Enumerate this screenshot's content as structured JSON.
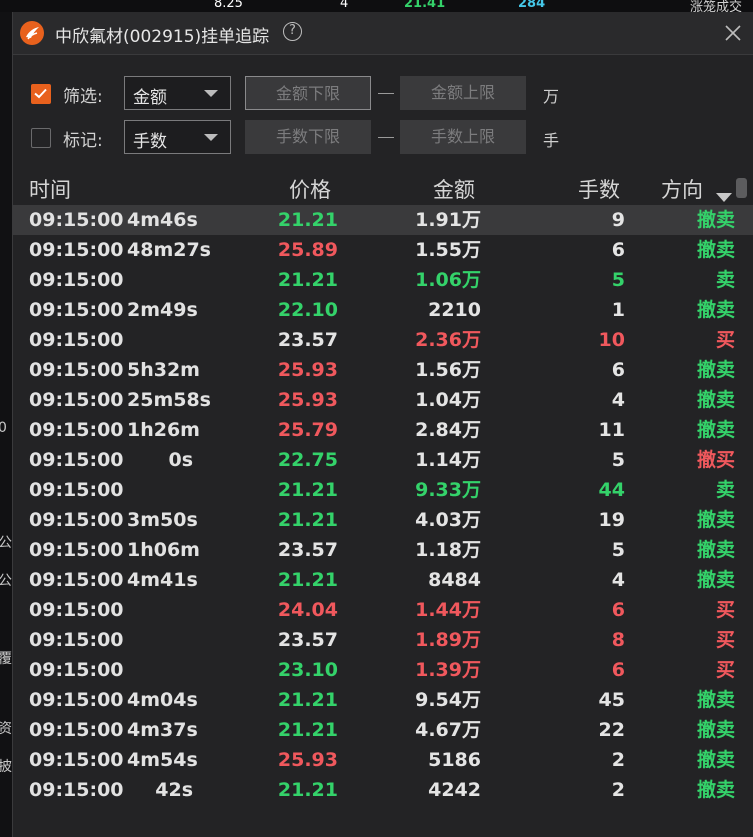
{
  "background_window": {
    "top_texts": [
      "8.25",
      "4",
      "21.41",
      "284",
      "涨笼成交"
    ],
    "left_edge_texts": [
      "0",
      "公",
      "公",
      "覆",
      "资",
      "披"
    ]
  },
  "window": {
    "title": "中欣氟材(002915)挂单追踪",
    "help_glyph": "?"
  },
  "filter_row": {
    "checkbox_checked": true,
    "label": "筛选:",
    "select_value": "金额",
    "lower_placeholder": "金额下限",
    "upper_placeholder": "金额上限",
    "unit": "万"
  },
  "mark_row": {
    "checkbox_checked": false,
    "label": "标记:",
    "select_value": "手数",
    "lower_placeholder": "手数下限",
    "upper_placeholder": "手数上限",
    "unit": "手"
  },
  "table": {
    "headers": {
      "time": "时间",
      "price": "价格",
      "amount": "金额",
      "lots": "手数",
      "direction": "方向"
    },
    "rows": [
      {
        "time": "09:15:00",
        "duration": "4m46s",
        "price": "21.21",
        "price_color": "g",
        "amount": "1.91万",
        "amount_color": "w",
        "lots": "9",
        "lots_color": "w",
        "direction": "撤卖",
        "direction_color": "g"
      },
      {
        "time": "09:15:00",
        "duration": "48m27s",
        "price": "25.89",
        "price_color": "r",
        "amount": "1.55万",
        "amount_color": "w",
        "lots": "6",
        "lots_color": "w",
        "direction": "撤卖",
        "direction_color": "g"
      },
      {
        "time": "09:15:00",
        "duration": "",
        "price": "21.21",
        "price_color": "g",
        "amount": "1.06万",
        "amount_color": "g",
        "lots": "5",
        "lots_color": "g",
        "direction": "卖",
        "direction_color": "g"
      },
      {
        "time": "09:15:00",
        "duration": "2m49s",
        "price": "22.10",
        "price_color": "g",
        "amount": "2210",
        "amount_color": "w",
        "lots": "1",
        "lots_color": "w",
        "direction": "撤卖",
        "direction_color": "g"
      },
      {
        "time": "09:15:00",
        "duration": "",
        "price": "23.57",
        "price_color": "w",
        "amount": "2.36万",
        "amount_color": "r",
        "lots": "10",
        "lots_color": "r",
        "direction": "买",
        "direction_color": "r"
      },
      {
        "time": "09:15:00",
        "duration": "5h32m",
        "price": "25.93",
        "price_color": "r",
        "amount": "1.56万",
        "amount_color": "w",
        "lots": "6",
        "lots_color": "w",
        "direction": "撤卖",
        "direction_color": "g"
      },
      {
        "time": "09:15:00",
        "duration": "25m58s",
        "price": "25.93",
        "price_color": "r",
        "amount": "1.04万",
        "amount_color": "w",
        "lots": "4",
        "lots_color": "w",
        "direction": "撤卖",
        "direction_color": "g"
      },
      {
        "time": "09:15:00",
        "duration": "1h26m",
        "price": "25.79",
        "price_color": "r",
        "amount": "2.84万",
        "amount_color": "w",
        "lots": "11",
        "lots_color": "w",
        "direction": "撤卖",
        "direction_color": "g"
      },
      {
        "time": "09:15:00",
        "duration": "0s",
        "price": "22.75",
        "price_color": "g",
        "amount": "1.14万",
        "amount_color": "w",
        "lots": "5",
        "lots_color": "w",
        "direction": "撤买",
        "direction_color": "r"
      },
      {
        "time": "09:15:00",
        "duration": "",
        "price": "21.21",
        "price_color": "g",
        "amount": "9.33万",
        "amount_color": "g",
        "lots": "44",
        "lots_color": "g",
        "direction": "卖",
        "direction_color": "g"
      },
      {
        "time": "09:15:00",
        "duration": "3m50s",
        "price": "21.21",
        "price_color": "g",
        "amount": "4.03万",
        "amount_color": "w",
        "lots": "19",
        "lots_color": "w",
        "direction": "撤卖",
        "direction_color": "g"
      },
      {
        "time": "09:15:00",
        "duration": "1h06m",
        "price": "23.57",
        "price_color": "w",
        "amount": "1.18万",
        "amount_color": "w",
        "lots": "5",
        "lots_color": "w",
        "direction": "撤卖",
        "direction_color": "g"
      },
      {
        "time": "09:15:00",
        "duration": "4m41s",
        "price": "21.21",
        "price_color": "g",
        "amount": "8484",
        "amount_color": "w",
        "lots": "4",
        "lots_color": "w",
        "direction": "撤卖",
        "direction_color": "g"
      },
      {
        "time": "09:15:00",
        "duration": "",
        "price": "24.04",
        "price_color": "r",
        "amount": "1.44万",
        "amount_color": "r",
        "lots": "6",
        "lots_color": "r",
        "direction": "买",
        "direction_color": "r"
      },
      {
        "time": "09:15:00",
        "duration": "",
        "price": "23.57",
        "price_color": "w",
        "amount": "1.89万",
        "amount_color": "r",
        "lots": "8",
        "lots_color": "r",
        "direction": "买",
        "direction_color": "r"
      },
      {
        "time": "09:15:00",
        "duration": "",
        "price": "23.10",
        "price_color": "g",
        "amount": "1.39万",
        "amount_color": "r",
        "lots": "6",
        "lots_color": "r",
        "direction": "买",
        "direction_color": "r"
      },
      {
        "time": "09:15:00",
        "duration": "4m04s",
        "price": "21.21",
        "price_color": "g",
        "amount": "9.54万",
        "amount_color": "w",
        "lots": "45",
        "lots_color": "w",
        "direction": "撤卖",
        "direction_color": "g"
      },
      {
        "time": "09:15:00",
        "duration": "4m37s",
        "price": "21.21",
        "price_color": "g",
        "amount": "4.67万",
        "amount_color": "w",
        "lots": "22",
        "lots_color": "w",
        "direction": "撤卖",
        "direction_color": "g"
      },
      {
        "time": "09:15:00",
        "duration": "4m54s",
        "price": "25.93",
        "price_color": "r",
        "amount": "5186",
        "amount_color": "w",
        "lots": "2",
        "lots_color": "w",
        "direction": "撤卖",
        "direction_color": "g"
      },
      {
        "time": "09:15:00",
        "duration": "42s",
        "price": "21.21",
        "price_color": "g",
        "amount": "4242",
        "amount_color": "w",
        "lots": "2",
        "lots_color": "w",
        "direction": "撤卖",
        "direction_color": "g"
      }
    ]
  },
  "colors": {
    "accent": "#e8611d",
    "up_red": "#f0585d",
    "down_green": "#34d26a",
    "window_bg": "#232325"
  }
}
